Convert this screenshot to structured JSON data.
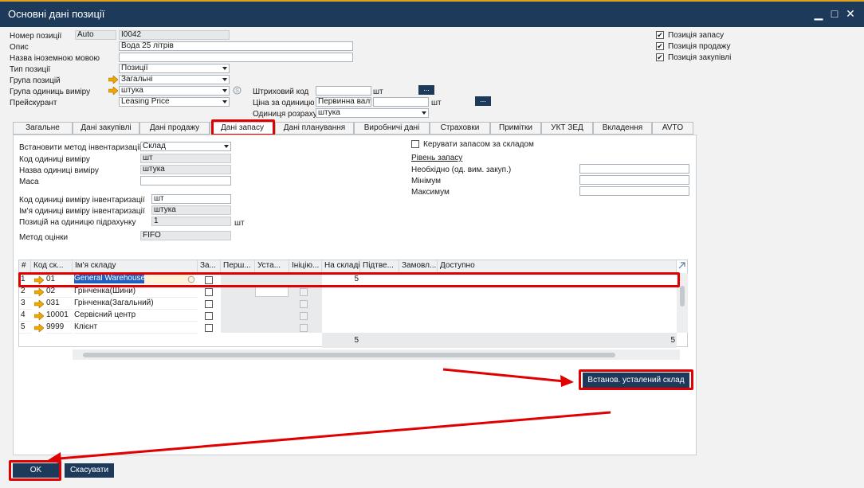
{
  "window": {
    "title": "Основні дані позиції"
  },
  "header": {
    "item_number_label": "Номер позиції",
    "item_number_mode": "Auto",
    "item_number_value": "I0042",
    "description_label": "Опис",
    "description_value": "Вода 25 літрів",
    "foreign_name_label": "Назва іноземною мовою",
    "foreign_name_value": "",
    "item_type_label": "Тип позиції",
    "item_type_value": "Позиції",
    "item_group_label": "Група позицій",
    "item_group_value": "Загальні",
    "uom_group_label": "Група одиниць виміру",
    "uom_group_value": "штука",
    "price_list_label": "Прейскурант",
    "price_list_value": "Leasing Price",
    "barcode_label": "Штриховий код",
    "barcode_value": "",
    "barcode_unit": "шт",
    "unit_price_label": "Ціна за одиницю",
    "unit_price_currency": "Первинна вал▾",
    "unit_price_value": "",
    "unit_price_unit": "шт",
    "pricing_unit_label": "Одиниця розрахунку",
    "pricing_unit_value": "штука",
    "ellipsis": "..."
  },
  "checkboxes": {
    "inventory_item": {
      "label": "Позиція запасу",
      "checked": "✔"
    },
    "sales_item": {
      "label": "Позиція продажу",
      "checked": "✔"
    },
    "purchase_item": {
      "label": "Позиція закупівлі",
      "checked": "✔"
    }
  },
  "tabs": [
    {
      "label": "Загальне"
    },
    {
      "label": "Дані закупівлі"
    },
    {
      "label": "Дані продажу"
    },
    {
      "label": "Дані запасу"
    },
    {
      "label": "Дані планування"
    },
    {
      "label": "Виробничі дані"
    },
    {
      "label": "Страховки"
    },
    {
      "label": "Примітки"
    },
    {
      "label": "УКТ ЗЕД"
    },
    {
      "label": "Вкладення"
    },
    {
      "label": "AVTO"
    }
  ],
  "inventory": {
    "method_label": "Встановити метод інвентаризації",
    "method_value": "Склад",
    "uom_code_label": "Код одиниці виміру",
    "uom_code_value": "шт",
    "uom_name_label": "Назва одиниці виміру",
    "uom_name_value": "штука",
    "weight_label": "Маса",
    "weight_value": "",
    "inv_uom_code_label": "Код одиниці виміру інвентаризації",
    "inv_uom_code_value": "шт",
    "inv_uom_name_label": "Ім'я одиниці виміру інвентаризації",
    "inv_uom_name_value": "штука",
    "items_per_count_label": "Позицій на одиницю підрахунку",
    "items_per_count_value": "1",
    "items_per_count_unit": "шт",
    "valuation_label": "Метод оцінки",
    "valuation_value": "FIFO",
    "manage_by_wh_label": "Керувати запасом за складом",
    "stock_level_label": "Рівень запасу",
    "required_label": "Необхідно (од. вим. закуп.)",
    "minimum_label": "Мінімум",
    "maximum_label": "Максимум"
  },
  "grid": {
    "headers": [
      "#",
      "Код ск...",
      "Ім'я складу",
      "За...",
      "Перш...",
      "Уста...",
      "Ініцію...",
      "На складі",
      "Підтве...",
      "Замовл...",
      "Доступно"
    ],
    "rows": [
      {
        "num": "1",
        "code": "01",
        "name": "General Warehouse",
        "instock": "5"
      },
      {
        "num": "2",
        "code": "02",
        "name": "Грінченка(Шини)",
        "instock": ""
      },
      {
        "num": "3",
        "code": "031",
        "name": "Грінченка(Загальний)",
        "instock": ""
      },
      {
        "num": "4",
        "code": "10001",
        "name": "Сервісний центр",
        "instock": ""
      },
      {
        "num": "5",
        "code": "9999",
        "name": "Клієнт",
        "instock": ""
      }
    ],
    "total_instock": "5",
    "total_available": "5"
  },
  "buttons": {
    "set_default_wh": "Встанов. усталений склад",
    "ok": "OK",
    "cancel": "Скасувати"
  },
  "colors": {
    "title_bar": "#1e3a5b",
    "accent_red": "#e00000",
    "link_arrow": "#f0a800"
  }
}
